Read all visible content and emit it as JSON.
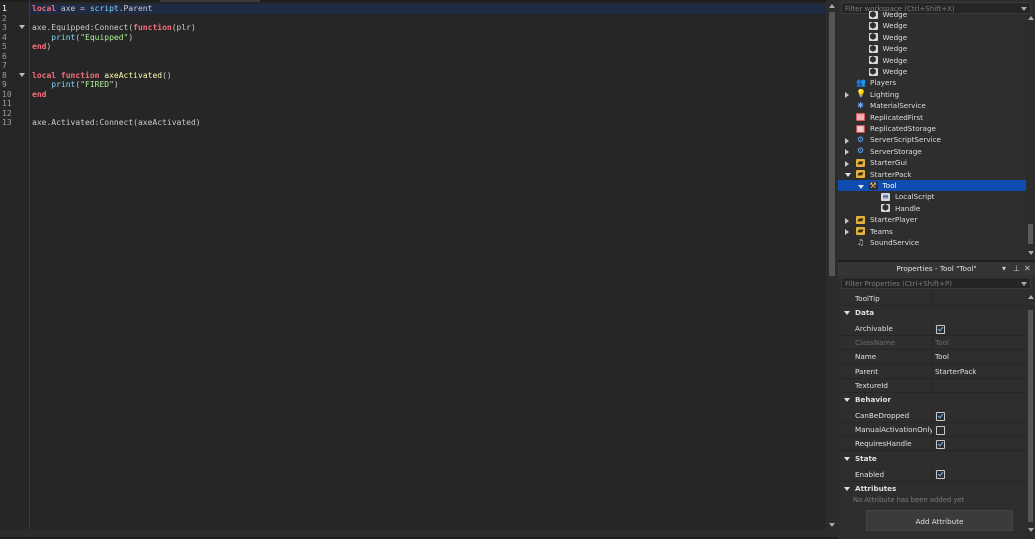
{
  "editor": {
    "lines": [
      {
        "num": "1",
        "current": true,
        "fold": false,
        "tokens": [
          [
            "kw",
            "local"
          ],
          [
            "p",
            " axe = "
          ],
          [
            "bi",
            "script"
          ],
          [
            "p",
            ".Parent"
          ]
        ]
      },
      {
        "num": "2",
        "current": false,
        "fold": false,
        "tokens": []
      },
      {
        "num": "3",
        "current": false,
        "fold": true,
        "tokens": [
          [
            "p",
            "axe.Equipped:"
          ],
          [
            "p",
            "Connect"
          ],
          [
            "p",
            "("
          ],
          [
            "kw",
            "function"
          ],
          [
            "p",
            "(plr)"
          ]
        ]
      },
      {
        "num": "4",
        "current": false,
        "fold": false,
        "tokens": [
          [
            "p",
            "    "
          ],
          [
            "bi",
            "print"
          ],
          [
            "p",
            "("
          ],
          [
            "str",
            "\"Equipped\""
          ],
          [
            "p",
            ")"
          ]
        ]
      },
      {
        "num": "5",
        "current": false,
        "fold": false,
        "tokens": [
          [
            "kw",
            "end"
          ],
          [
            "p",
            ")"
          ]
        ]
      },
      {
        "num": "6",
        "current": false,
        "fold": false,
        "tokens": []
      },
      {
        "num": "7",
        "current": false,
        "fold": false,
        "tokens": []
      },
      {
        "num": "8",
        "current": false,
        "fold": true,
        "tokens": [
          [
            "kw",
            "local"
          ],
          [
            "p",
            " "
          ],
          [
            "kw",
            "function"
          ],
          [
            "p",
            " "
          ],
          [
            "fn",
            "axeActivated"
          ],
          [
            "p",
            "()"
          ]
        ]
      },
      {
        "num": "9",
        "current": false,
        "fold": false,
        "tokens": [
          [
            "p",
            "    "
          ],
          [
            "bi",
            "print"
          ],
          [
            "p",
            "("
          ],
          [
            "str",
            "\"FIRED\""
          ],
          [
            "p",
            ")"
          ]
        ]
      },
      {
        "num": "10",
        "current": false,
        "fold": false,
        "tokens": [
          [
            "kw",
            "end"
          ]
        ]
      },
      {
        "num": "11",
        "current": false,
        "fold": false,
        "tokens": []
      },
      {
        "num": "12",
        "current": false,
        "fold": false,
        "tokens": []
      },
      {
        "num": "13",
        "current": false,
        "fold": false,
        "tokens": [
          [
            "p",
            "axe.Activated:"
          ],
          [
            "p",
            "Connect"
          ],
          [
            "p",
            "(axeActivated)"
          ]
        ]
      }
    ]
  },
  "explorer": {
    "filter_placeholder": "Filter workspace (Ctrl+Shift+X)",
    "items": [
      {
        "label": "Wedge",
        "depth": 2,
        "expander": "none",
        "icon": "part-icon",
        "selected": false
      },
      {
        "label": "Wedge",
        "depth": 2,
        "expander": "none",
        "icon": "part-icon",
        "selected": false
      },
      {
        "label": "Wedge",
        "depth": 2,
        "expander": "none",
        "icon": "part-icon",
        "selected": false
      },
      {
        "label": "Wedge",
        "depth": 2,
        "expander": "none",
        "icon": "part-icon",
        "selected": false
      },
      {
        "label": "Wedge",
        "depth": 2,
        "expander": "none",
        "icon": "part-icon",
        "selected": false
      },
      {
        "label": "Wedge",
        "depth": 2,
        "expander": "none",
        "icon": "part-icon",
        "selected": false
      },
      {
        "label": "Players",
        "depth": 1,
        "expander": "none",
        "icon": "players-icon",
        "selected": false
      },
      {
        "label": "Lighting",
        "depth": 1,
        "expander": "collapsed",
        "icon": "lightbulb-icon",
        "selected": false
      },
      {
        "label": "MaterialService",
        "depth": 1,
        "expander": "none",
        "icon": "material-service-icon",
        "selected": false
      },
      {
        "label": "ReplicatedFirst",
        "depth": 1,
        "expander": "none",
        "icon": "replicated-first-icon",
        "selected": false
      },
      {
        "label": "ReplicatedStorage",
        "depth": 1,
        "expander": "none",
        "icon": "replicated-storage-icon",
        "selected": false
      },
      {
        "label": "ServerScriptService",
        "depth": 1,
        "expander": "collapsed",
        "icon": "server-script-service-icon",
        "selected": false
      },
      {
        "label": "ServerStorage",
        "depth": 1,
        "expander": "collapsed",
        "icon": "server-storage-icon",
        "selected": false
      },
      {
        "label": "StarterGui",
        "depth": 1,
        "expander": "collapsed",
        "icon": "folder-icon",
        "selected": false
      },
      {
        "label": "StarterPack",
        "depth": 1,
        "expander": "expanded",
        "icon": "folder-icon",
        "selected": false
      },
      {
        "label": "Tool",
        "depth": 2,
        "expander": "expanded",
        "icon": "hammer-icon",
        "selected": true
      },
      {
        "label": "LocalScript",
        "depth": 3,
        "expander": "none",
        "icon": "local-script-icon",
        "selected": false
      },
      {
        "label": "Handle",
        "depth": 3,
        "expander": "none",
        "icon": "part-icon",
        "selected": false
      },
      {
        "label": "StarterPlayer",
        "depth": 1,
        "expander": "collapsed",
        "icon": "folder-icon",
        "selected": false
      },
      {
        "label": "Teams",
        "depth": 1,
        "expander": "collapsed",
        "icon": "folder-icon",
        "selected": false
      },
      {
        "label": "SoundService",
        "depth": 1,
        "expander": "none",
        "icon": "sound-icon",
        "selected": false
      }
    ]
  },
  "properties": {
    "title": "Properties - Tool \"Tool\"",
    "filter_placeholder": "Filter Properties (Ctrl+Shift+P)",
    "rows": [
      {
        "kind": "row",
        "name": "ToolTip",
        "value": "",
        "dim": false
      },
      {
        "kind": "header",
        "name": "Data"
      },
      {
        "kind": "row",
        "name": "Archivable",
        "checkbox": true,
        "checked": true
      },
      {
        "kind": "row",
        "name": "ClassName",
        "value": "Tool",
        "dim": true
      },
      {
        "kind": "row",
        "name": "Name",
        "value": "Tool",
        "dim": false
      },
      {
        "kind": "row",
        "name": "Parent",
        "value": "StarterPack",
        "dim": false
      },
      {
        "kind": "row",
        "name": "TextureId",
        "value": "",
        "dim": false
      },
      {
        "kind": "header",
        "name": "Behavior"
      },
      {
        "kind": "row",
        "name": "CanBeDropped",
        "checkbox": true,
        "checked": true
      },
      {
        "kind": "row",
        "name": "ManualActivationOnly",
        "checkbox": true,
        "checked": false
      },
      {
        "kind": "row",
        "name": "RequiresHandle",
        "checkbox": true,
        "checked": true
      },
      {
        "kind": "header",
        "name": "State"
      },
      {
        "kind": "row",
        "name": "Enabled",
        "checkbox": true,
        "checked": true
      },
      {
        "kind": "header",
        "name": "Attributes"
      }
    ],
    "attributes_note": "No Attribute has been added yet",
    "add_attribute_label": "Add Attribute"
  },
  "colors": {
    "keyword": "#f86d7c",
    "builtin": "#84d6f7",
    "string": "#adf195",
    "function_name": "#fdfbac",
    "selection": "#0f4cb0"
  }
}
